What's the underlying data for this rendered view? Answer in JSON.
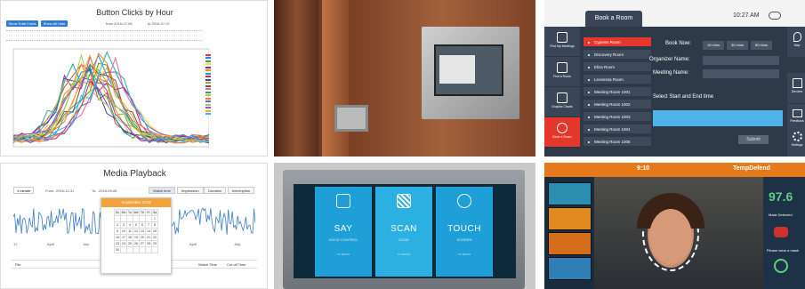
{
  "button_clicks": {
    "title": "Button Clicks by Hour",
    "buttons": [
      "Show Total Clicks",
      "Show All Hide"
    ],
    "date_from": "from 2016-07-06",
    "date_to": "to 2016-07-07",
    "legend_rows": [
      "Show all",
      "Show all"
    ],
    "series_colors": [
      "#e53935",
      "#1e88e5",
      "#43a047",
      "#fdd835",
      "#8e24aa",
      "#fb8c00",
      "#00acc1",
      "#d81b60",
      "#3949ab",
      "#7cb342",
      "#6d4c41",
      "#f06292",
      "#26a69a",
      "#c0ca33",
      "#ff7043",
      "#5c6bc0",
      "#9ccc65",
      "#ab47bc",
      "#ffa726",
      "#29b6f6"
    ]
  },
  "book_room": {
    "title": "Book a Room",
    "time": "10:27 AM",
    "book_now_label": "Book Now:",
    "book_now_options": [
      "15 mins",
      "30 mins",
      "60 mins"
    ],
    "organizer_label": "Organizer Name:",
    "meeting_label": "Meeting Name:",
    "select_label": "Select Start and End time",
    "submit_label": "Submit",
    "rooms": [
      "Cypress Room",
      "Discovery Room",
      "Eliza Room",
      "Leonessa Room",
      "Meeting Room 1001",
      "Meeting Room 1002",
      "Meeting Room 1003",
      "Meeting Room 1004",
      "Meeting Room 1005"
    ],
    "left_nav": [
      "Find My Meetings",
      "Find a Room",
      "Graphic Charts",
      "Book a Room"
    ],
    "right_nav": [
      "Map",
      "Devices",
      "Feedback",
      "Settings"
    ]
  },
  "media_playback": {
    "title": "Media Playback",
    "filter": "1 minute",
    "from_label": "From:",
    "from_value": "2016-12-31",
    "to_label": "To:",
    "to_value": "2018-09-08",
    "tabs": [
      "Watch time",
      "Impression",
      "Duration",
      "Interruption"
    ],
    "calendar_month": "September 2018",
    "calendar_days": [
      "Su",
      "Mo",
      "Tu",
      "We",
      "Th",
      "Fr",
      "Sa"
    ],
    "calendar_dates": [
      "",
      "",
      "",
      "",
      "",
      "",
      "1",
      "2",
      "3",
      "4",
      "5",
      "6",
      "7",
      "8",
      "9",
      "10",
      "11",
      "12",
      "13",
      "14",
      "15",
      "16",
      "17",
      "18",
      "19",
      "20",
      "21",
      "22",
      "23",
      "24",
      "25",
      "26",
      "27",
      "28",
      "29",
      "30"
    ],
    "x_ticks": [
      "17",
      "April",
      "July",
      "April",
      "July"
    ],
    "table_headers": [
      "File",
      "Watch Time",
      "Cut off Time"
    ]
  },
  "kiosk": {
    "panels": [
      {
        "title": "SAY",
        "sub": "VOICE CONTROL",
        "go": "TO BEGIN"
      },
      {
        "title": "SCAN",
        "sub": "CODE",
        "go": "TO BEGIN"
      },
      {
        "title": "TOUCH",
        "sub": "SCREEN",
        "go": "TO BEGIN"
      }
    ]
  },
  "tempdefend": {
    "time": "9:10",
    "brand": "TempDefend",
    "temperature": "97.6",
    "mask_label": "Mask Detected",
    "proceed_label": "Please wear a mask"
  }
}
